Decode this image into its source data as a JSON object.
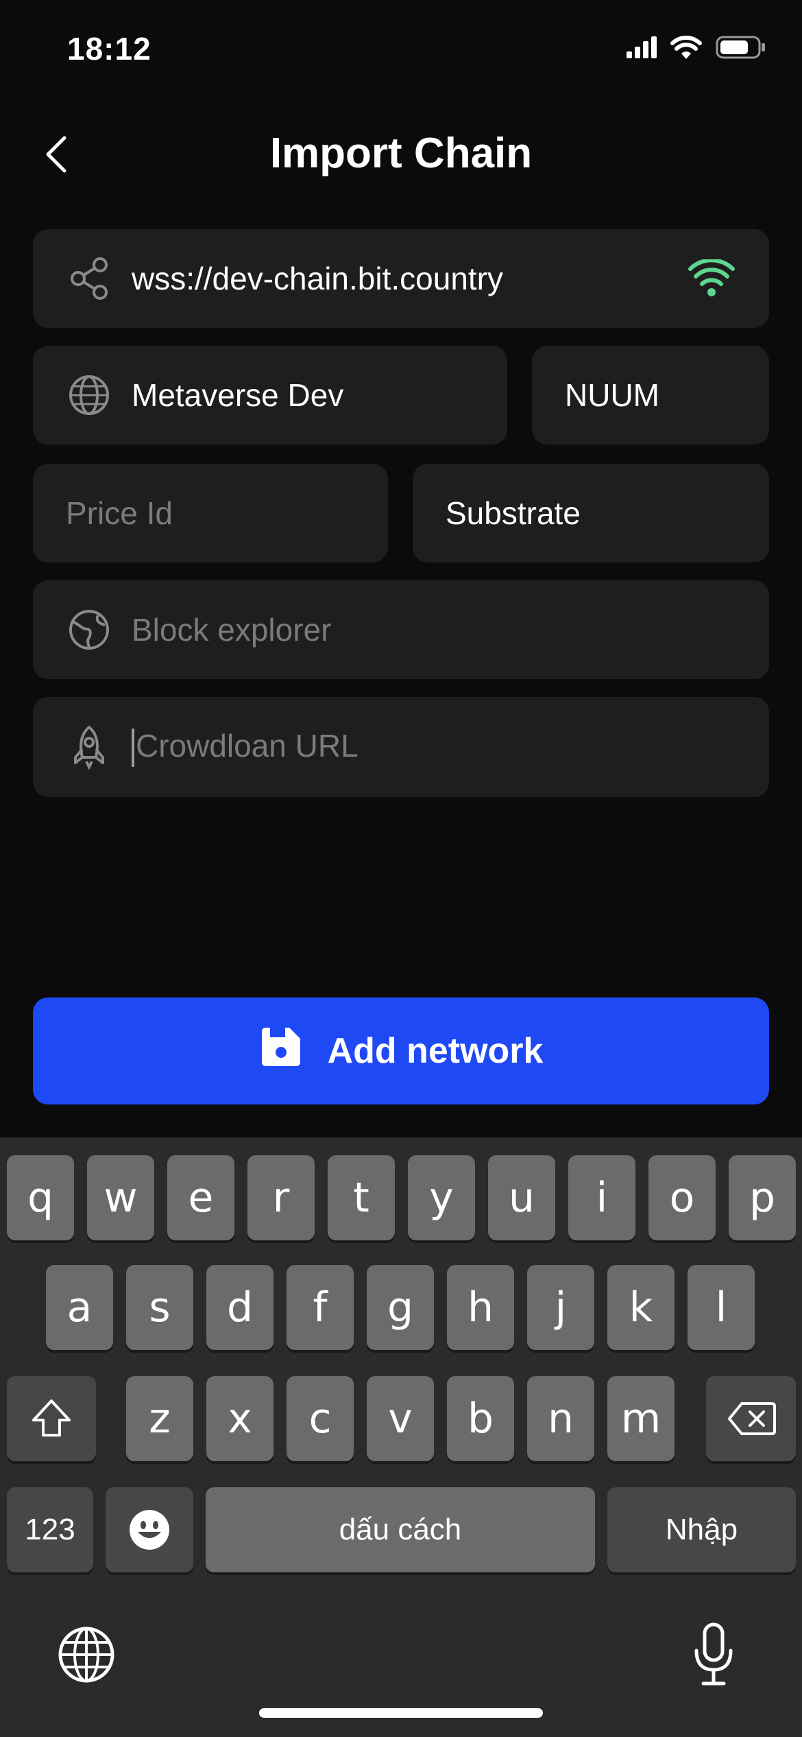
{
  "status_bar": {
    "time": "18:12"
  },
  "header": {
    "title": "Import Chain"
  },
  "form": {
    "rpc_url": {
      "value": "wss://dev-chain.bit.country"
    },
    "network_name": {
      "value": "Metaverse Dev"
    },
    "symbol": {
      "value": "NUUM"
    },
    "price_id": {
      "placeholder": "Price Id"
    },
    "network_type": {
      "value": "Substrate"
    },
    "block_explorer": {
      "placeholder": "Block explorer"
    },
    "crowdloan_url": {
      "placeholder": "Crowdloan URL"
    }
  },
  "add_button": {
    "label": "Add network"
  },
  "keyboard": {
    "row1": [
      "q",
      "w",
      "e",
      "r",
      "t",
      "y",
      "u",
      "i",
      "o",
      "p"
    ],
    "row2": [
      "a",
      "s",
      "d",
      "f",
      "g",
      "h",
      "j",
      "k",
      "l"
    ],
    "row3": [
      "z",
      "x",
      "c",
      "v",
      "b",
      "n",
      "m"
    ],
    "numbers_label": "123",
    "space_label": "dấu cách",
    "return_label": "Nhập"
  },
  "colors": {
    "background": "#0b0b0b",
    "field": "#1e1e1e",
    "accent_blue": "#1f49f5",
    "connected_green": "#5fd68f"
  },
  "icons": [
    "back-chevron-icon",
    "share-icon",
    "wifi-connected-icon",
    "globe-icon",
    "explorer-icon",
    "rocket-icon",
    "floppy-disk-icon",
    "shift-icon",
    "delete-icon",
    "emoji-icon",
    "keyboard-globe-icon",
    "microphone-icon"
  ]
}
